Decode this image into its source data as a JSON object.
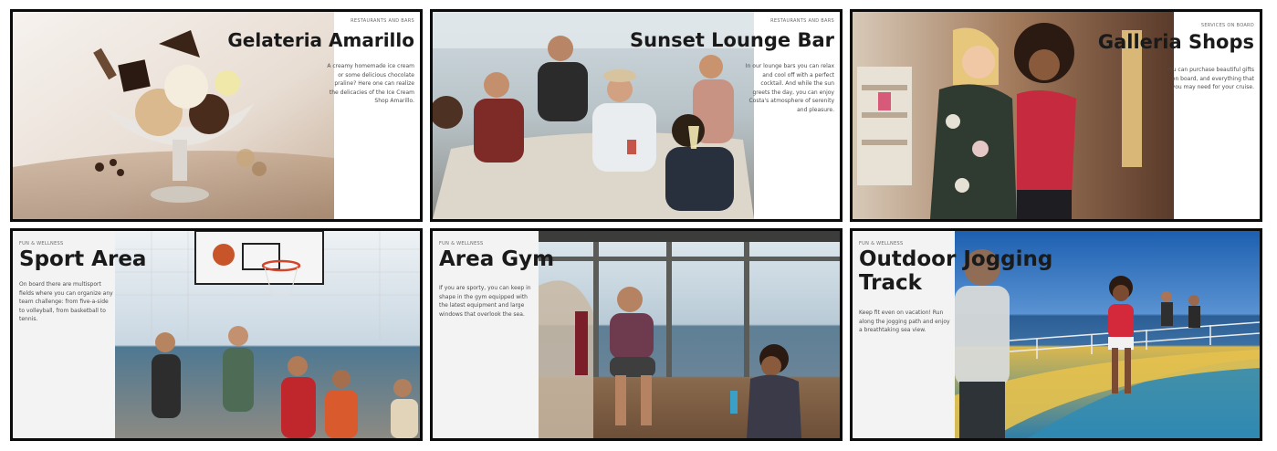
{
  "cards": [
    {
      "category": "RESTAURANTS AND BARS",
      "title": "Gelateria Amarillo",
      "description": "A creamy homemade ice cream or some delicious chocolate praline? Here one can realize the delicacies of the Ice Cream Shop Amarillo."
    },
    {
      "category": "RESTAURANTS AND BARS",
      "title": "Sunset Lounge Bar",
      "description": "In our lounge bars you can relax and cool off with a perfect cocktail. And while the sun greets the day, you can enjoy Costa's atmosphere of serenity and pleasure."
    },
    {
      "category": "SERVICES ON BOARD",
      "title": "Galleria Shops",
      "description": "You can purchase beautiful gifts on board, and everything that you may need for your cruise."
    },
    {
      "category": "FUN & WELLNESS",
      "title": "Sport Area",
      "description": "On board there are multisport fields where you can organize any team challenge: from five-a-side to volleyball, from basketball to tennis."
    },
    {
      "category": "FUN & WELLNESS",
      "title": "Area Gym",
      "description": "If you are sporty, you can keep in shape in the gym equipped with the latest equipment and large windows that overlook the sea."
    },
    {
      "category": "FUN & WELLNESS",
      "title": "Outdoor Jogging Track",
      "title_line1": "Outdoor Jogging",
      "title_line2": "Track",
      "description": "Keep fit even on vacation! Run along the jogging path and enjoy a breathtaking sea view."
    }
  ],
  "colors": {
    "border": "#0b0b0b",
    "title": "#1a1a1a",
    "text": "#4c4c4c",
    "panel": "#ffffff",
    "panel_alt": "#f3f3f3"
  }
}
